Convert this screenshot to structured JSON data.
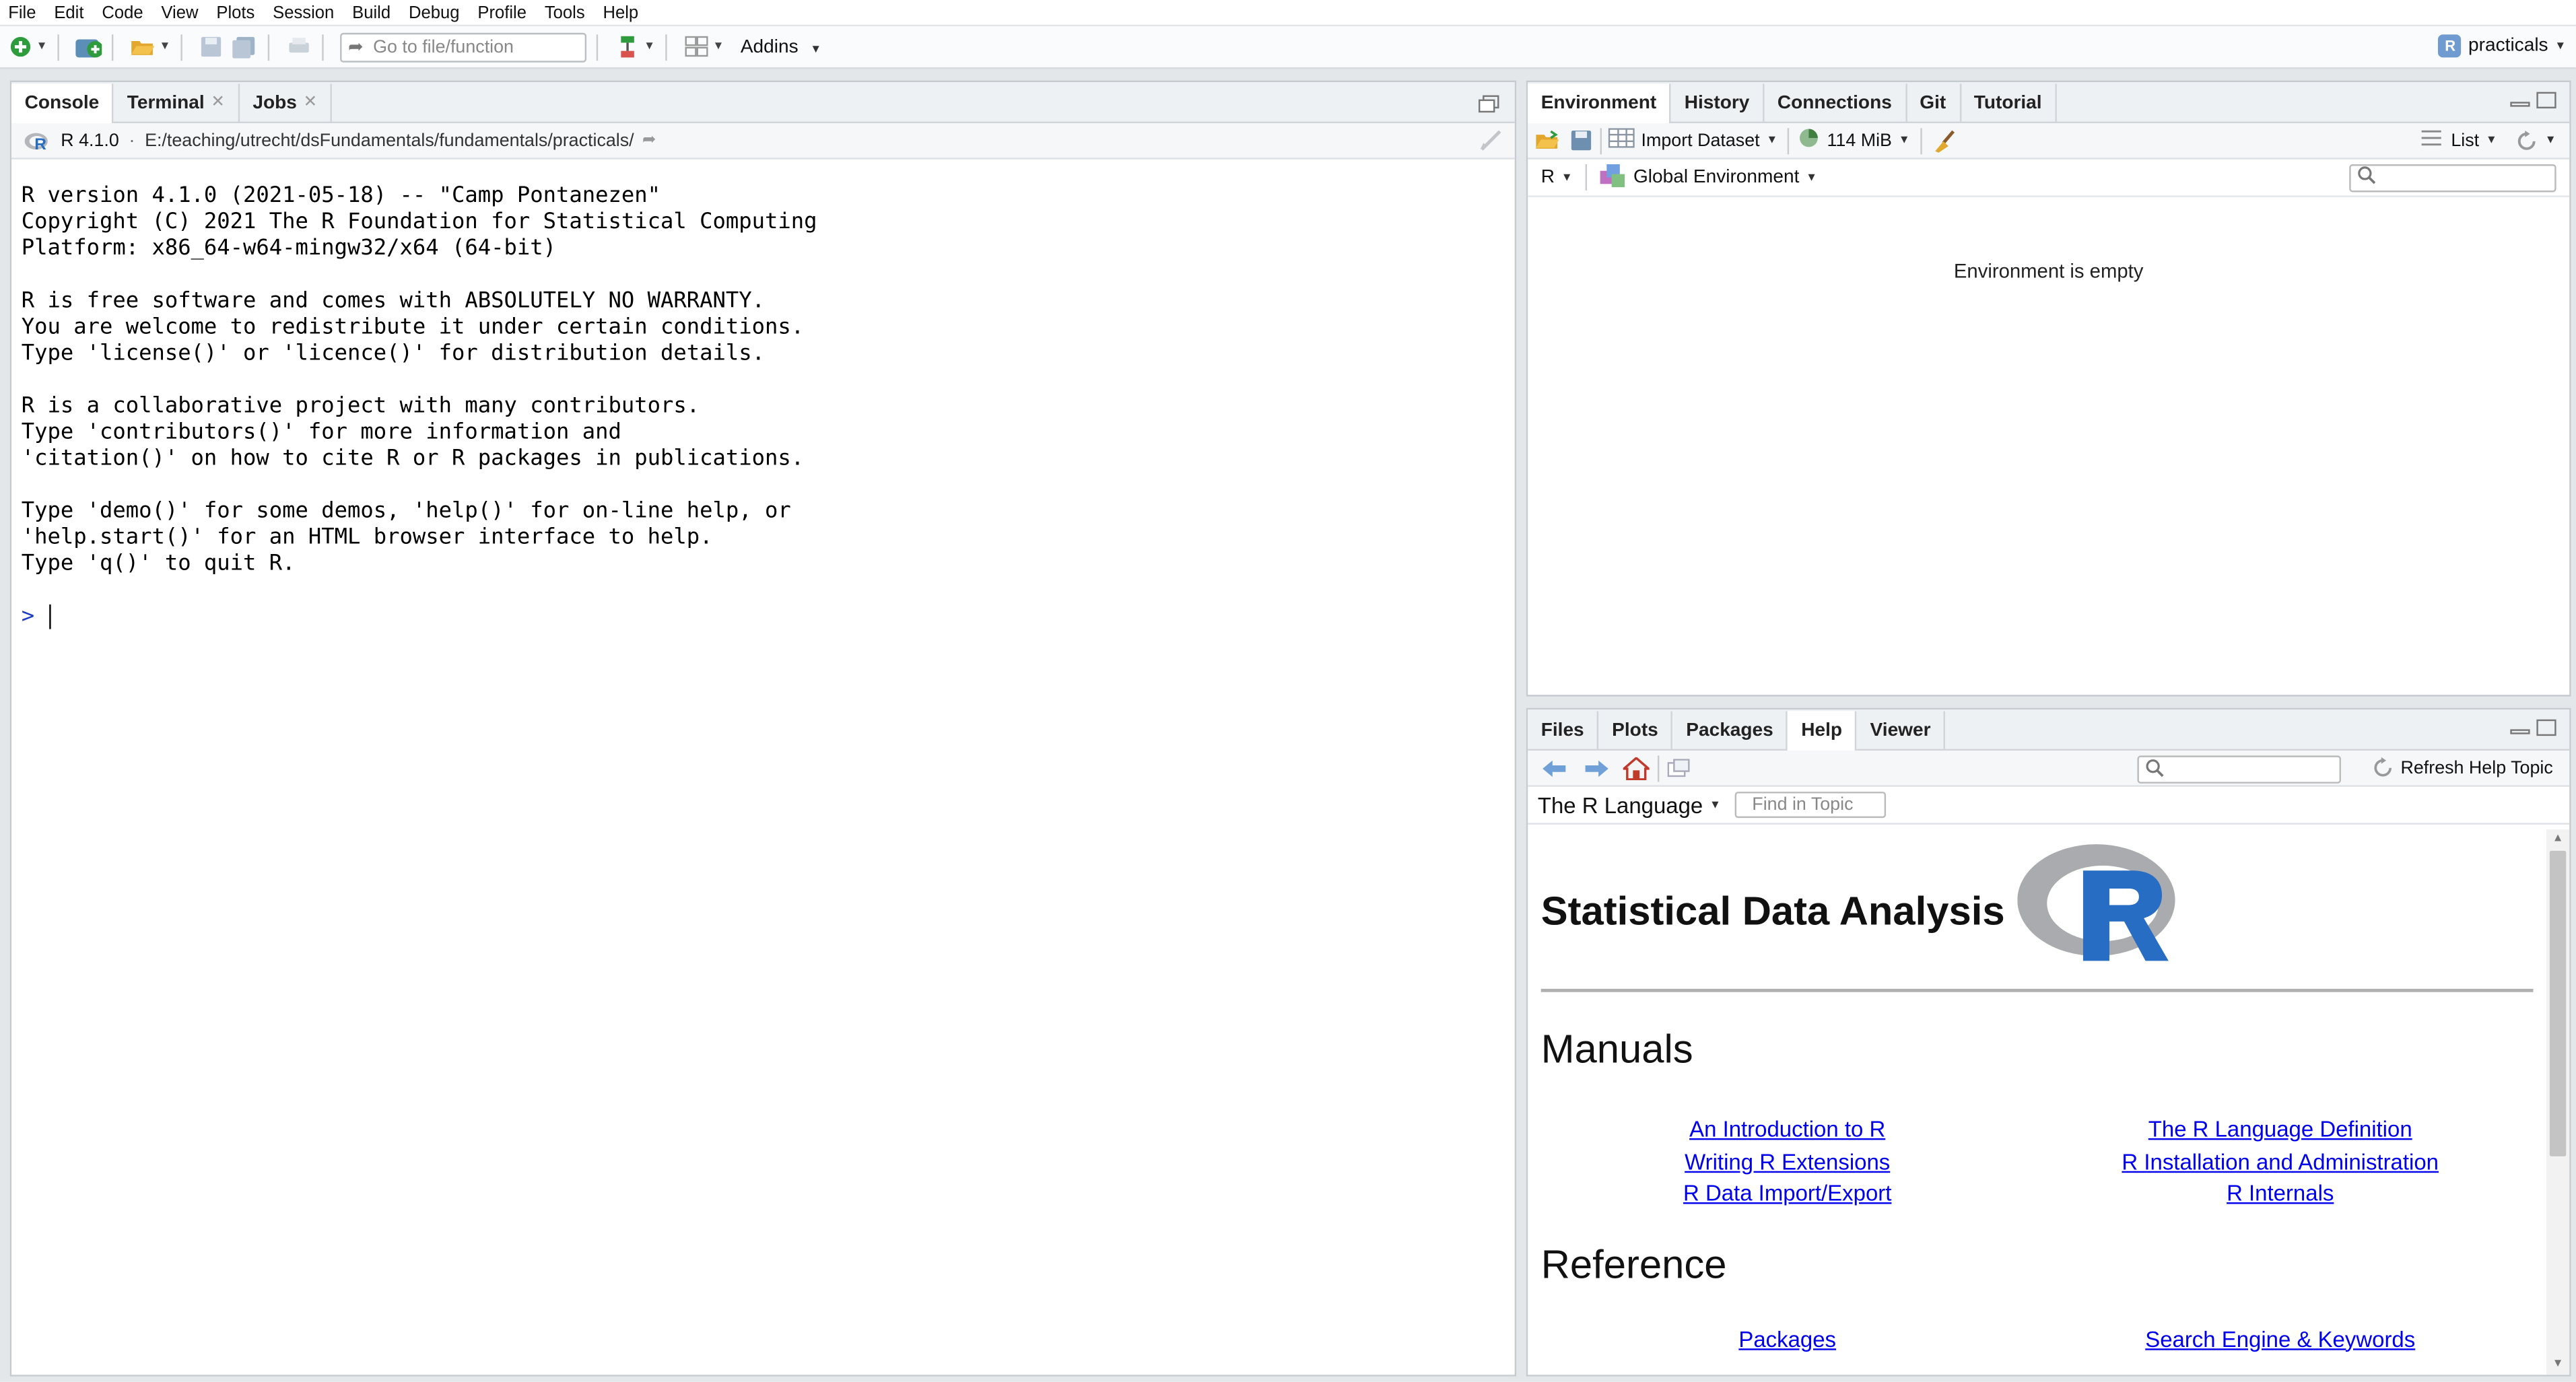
{
  "menu": [
    "File",
    "Edit",
    "Code",
    "View",
    "Plots",
    "Session",
    "Build",
    "Debug",
    "Profile",
    "Tools",
    "Help"
  ],
  "toolbar": {
    "goto_placeholder": "Go to file/function",
    "addins_label": "Addins",
    "project_label": "practicals"
  },
  "console_pane": {
    "tabs": [
      {
        "label": "Console"
      },
      {
        "label": "Terminal"
      },
      {
        "label": "Jobs"
      }
    ],
    "r_version": "R 4.1.0",
    "sep": "·",
    "path": "E:/teaching/utrecht/dsFundamentals/fundamentals/practicals/",
    "output": "R version 4.1.0 (2021-05-18) -- \"Camp Pontanezen\"\nCopyright (C) 2021 The R Foundation for Statistical Computing\nPlatform: x86_64-w64-mingw32/x64 (64-bit)\n\nR is free software and comes with ABSOLUTELY NO WARRANTY.\nYou are welcome to redistribute it under certain conditions.\nType 'license()' or 'licence()' for distribution details.\n\nR is a collaborative project with many contributors.\nType 'contributors()' for more information and\n'citation()' on how to cite R or R packages in publications.\n\nType 'demo()' for some demos, 'help()' for on-line help, or\n'help.start()' for an HTML browser interface to help.\nType 'q()' to quit R.",
    "prompt": ">"
  },
  "env_pane": {
    "tabs": [
      {
        "label": "Environment"
      },
      {
        "label": "History"
      },
      {
        "label": "Connections"
      },
      {
        "label": "Git"
      },
      {
        "label": "Tutorial"
      }
    ],
    "import_label": "Import Dataset",
    "memory_label": "114 MiB",
    "view_label": "List",
    "lang_label": "R",
    "scope_label": "Global Environment",
    "empty_text": "Environment is empty"
  },
  "help_pane": {
    "tabs": [
      {
        "label": "Files"
      },
      {
        "label": "Plots"
      },
      {
        "label": "Packages"
      },
      {
        "label": "Help"
      },
      {
        "label": "Viewer"
      }
    ],
    "refresh_label": "Refresh Help Topic",
    "topic_label": "The R Language",
    "find_placeholder": "Find in Topic",
    "heading": "Statistical Data Analysis",
    "manuals_heading": "Manuals",
    "manuals_left": [
      "An Introduction to R",
      "Writing R Extensions",
      "R Data Import/Export"
    ],
    "manuals_right": [
      "The R Language Definition",
      "R Installation and Administration",
      "R Internals"
    ],
    "reference_heading": "Reference",
    "reference_left": "Packages",
    "reference_right": "Search Engine & Keywords"
  }
}
